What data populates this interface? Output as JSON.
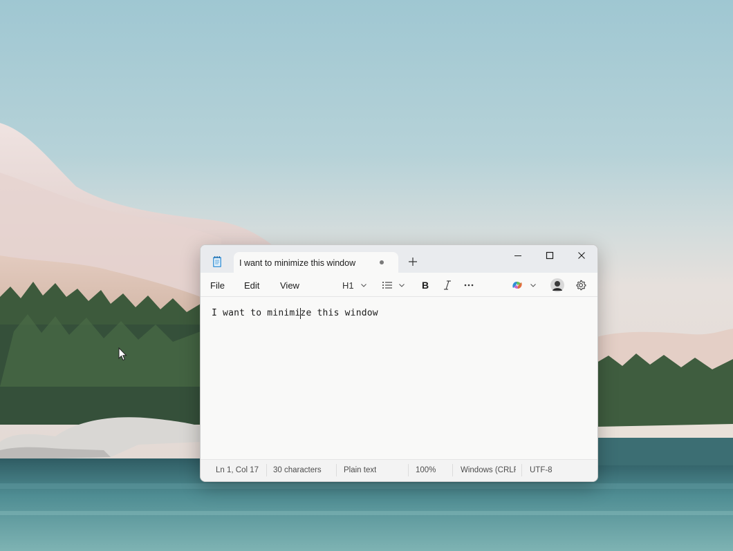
{
  "window": {
    "tab_title": "I want to minimize this window",
    "new_tab_icon": "plus-icon",
    "controls": [
      "minimize-icon",
      "maximize-icon",
      "close-icon"
    ]
  },
  "menu": {
    "file": "File",
    "edit": "Edit",
    "view": "View"
  },
  "toolbar": {
    "heading": "H1",
    "list_icon": "list-icon",
    "bold_icon": "bold-icon",
    "italic_icon": "italic-icon",
    "more_icon": "more-icon",
    "copilot_icon": "copilot-icon",
    "avatar": "avatar",
    "settings_icon": "gear-icon"
  },
  "editor": {
    "content": "I want to minimize this window"
  },
  "status": {
    "position": "Ln 1, Col 17",
    "characters": "30 characters",
    "format": "Plain text",
    "zoom": "100%",
    "line_ending": "Windows (CRLF)",
    "encoding": "UTF-8"
  },
  "colors": {
    "titlebar": "#e9ebee",
    "editor_bg": "#f9f9f8",
    "statusbar": "#f3f3f3"
  }
}
